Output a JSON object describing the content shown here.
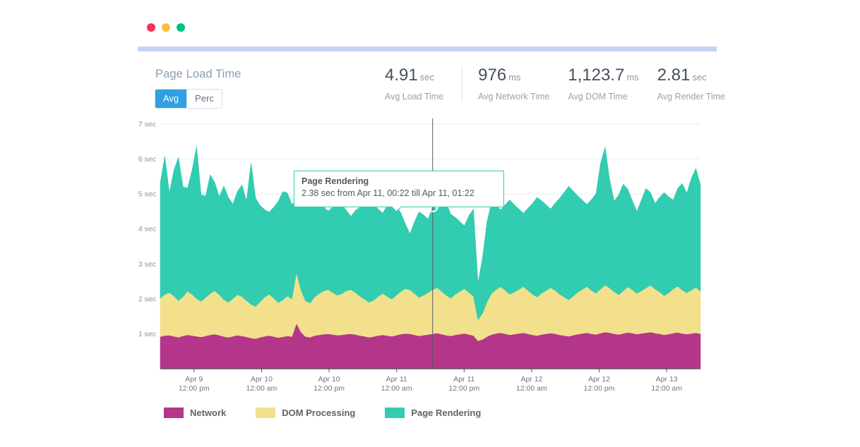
{
  "window": {
    "dots": [
      "close-red",
      "minimize-amber",
      "maximize-green"
    ],
    "accent_bar_color": "#c2d3f7"
  },
  "panel": {
    "title": "Page Load Time",
    "toggle": {
      "options": [
        {
          "label": "Avg",
          "active": true
        },
        {
          "label": "Perc",
          "active": false
        }
      ],
      "active_color": "#30a0e0"
    },
    "metrics": [
      {
        "value": "4.91",
        "unit": "sec",
        "label": "Avg Load Time"
      },
      {
        "value": "976",
        "unit": "ms",
        "label": "Avg Network Time"
      },
      {
        "value": "1,123.7",
        "unit": "ms",
        "label": "Avg DOM Time"
      },
      {
        "value": "2.81",
        "unit": "sec",
        "label": "Avg Render Time"
      }
    ]
  },
  "tooltip": {
    "title": "Page Rendering",
    "body": "2.38 sec from Apr 11, 00:22 till Apr 11, 01:22",
    "border_color": "#32ccb0"
  },
  "legend": [
    {
      "label": "Network",
      "color": "#b4368a"
    },
    {
      "label": "DOM Processing",
      "color": "#f2e08c"
    },
    {
      "label": "Page Rendering",
      "color": "#32ccb0"
    }
  ],
  "chart_data": {
    "type": "area",
    "stacked": true,
    "title": "Page Load Time",
    "xlabel": "",
    "ylabel": "",
    "grid": true,
    "legend_position": "bottom",
    "ylim": [
      0,
      7
    ],
    "yticks": [
      1,
      2,
      3,
      4,
      5,
      6,
      7
    ],
    "ytick_labels": [
      "1 sec",
      "2 sec",
      "3 sec",
      "4 sec",
      "5 sec",
      "6 sec",
      "7 sec"
    ],
    "xtick_labels": [
      [
        "Apr 9",
        "12:00 pm"
      ],
      [
        "Apr 10",
        "12:00 am"
      ],
      [
        "Apr 10",
        "12:00 pm"
      ],
      [
        "Apr 11",
        "12:00 am"
      ],
      [
        "Apr 11",
        "12:00 pm"
      ],
      [
        "Apr 12",
        "12:00 am"
      ],
      [
        "Apr 12",
        "12:00 pm"
      ],
      [
        "Apr 13",
        "12:00 am"
      ]
    ],
    "highlight": {
      "series": "Page Rendering",
      "value": 2.38,
      "x_label": "Apr 11, 00:22"
    },
    "series": [
      {
        "name": "Network",
        "color": "#b4368a",
        "values": [
          0.92,
          0.95,
          0.96,
          0.93,
          0.9,
          0.94,
          0.97,
          0.95,
          0.93,
          0.91,
          0.94,
          0.97,
          0.99,
          0.96,
          0.92,
          0.9,
          0.93,
          0.96,
          0.94,
          0.91,
          0.88,
          0.86,
          0.9,
          0.93,
          0.95,
          0.92,
          0.89,
          0.91,
          0.94,
          0.92,
          1.3,
          1.05,
          0.92,
          0.9,
          0.95,
          0.97,
          0.99,
          1.0,
          0.98,
          0.96,
          0.97,
          0.99,
          1.0,
          0.98,
          0.95,
          0.93,
          0.9,
          0.92,
          0.95,
          0.97,
          0.95,
          0.93,
          0.96,
          0.99,
          1.01,
          1.0,
          0.97,
          0.94,
          0.96,
          0.98,
          1.0,
          1.02,
          0.99,
          0.96,
          0.94,
          0.97,
          0.99,
          1.01,
          0.98,
          0.95,
          0.8,
          0.84,
          0.92,
          0.98,
          1.01,
          1.03,
          1.0,
          0.97,
          0.99,
          1.01,
          1.03,
          1.0,
          0.97,
          0.95,
          0.98,
          1.0,
          1.02,
          1.0,
          0.97,
          0.95,
          0.93,
          0.96,
          0.99,
          1.01,
          1.03,
          1.0,
          0.98,
          1.02,
          1.05,
          1.03,
          1.0,
          0.98,
          1.01,
          1.04,
          1.02,
          0.99,
          1.01,
          1.03,
          1.05,
          1.02,
          1.0,
          0.97,
          0.99,
          1.02,
          1.04,
          1.01,
          0.99,
          1.01,
          1.03,
          1.0
        ],
        "avg": 0.976
      },
      {
        "name": "DOM Processing",
        "color": "#f2e08c",
        "values": [
          1.1,
          1.18,
          1.22,
          1.15,
          1.05,
          1.12,
          1.25,
          1.18,
          1.08,
          1.02,
          1.1,
          1.18,
          1.24,
          1.16,
          1.06,
          1.0,
          1.08,
          1.16,
          1.12,
          1.04,
          0.96,
          0.92,
          1.02,
          1.12,
          1.18,
          1.1,
          1.0,
          1.06,
          1.14,
          1.08,
          1.45,
          1.2,
          1.02,
          0.98,
          1.1,
          1.18,
          1.24,
          1.26,
          1.2,
          1.14,
          1.18,
          1.24,
          1.26,
          1.2,
          1.12,
          1.06,
          1.0,
          1.04,
          1.12,
          1.18,
          1.12,
          1.06,
          1.14,
          1.22,
          1.28,
          1.26,
          1.18,
          1.1,
          1.14,
          1.2,
          1.26,
          1.3,
          1.22,
          1.14,
          1.08,
          1.16,
          1.22,
          1.28,
          1.2,
          1.12,
          0.6,
          0.75,
          1.0,
          1.18,
          1.26,
          1.32,
          1.24,
          1.16,
          1.2,
          1.26,
          1.32,
          1.24,
          1.16,
          1.1,
          1.18,
          1.24,
          1.3,
          1.24,
          1.16,
          1.1,
          1.04,
          1.12,
          1.2,
          1.26,
          1.32,
          1.24,
          1.18,
          1.26,
          1.34,
          1.28,
          1.2,
          1.14,
          1.22,
          1.3,
          1.24,
          1.16,
          1.22,
          1.28,
          1.34,
          1.26,
          1.2,
          1.12,
          1.18,
          1.26,
          1.32,
          1.24,
          1.18,
          1.24,
          1.3,
          1.22
        ],
        "avg": 1.1237
      },
      {
        "name": "Page Rendering",
        "color": "#32ccb0",
        "values": [
          3.3,
          3.95,
          2.85,
          3.6,
          4.1,
          3.15,
          2.95,
          3.55,
          4.35,
          3.05,
          2.9,
          3.4,
          3.1,
          2.8,
          3.25,
          3.0,
          2.7,
          2.95,
          3.2,
          2.85,
          4.05,
          3.1,
          2.75,
          2.5,
          2.35,
          2.6,
          2.9,
          3.1,
          2.95,
          2.7,
          2.05,
          2.6,
          3.0,
          3.15,
          2.9,
          2.6,
          2.4,
          2.25,
          2.45,
          2.7,
          2.55,
          2.3,
          2.1,
          2.35,
          2.55,
          2.8,
          3.0,
          2.75,
          2.5,
          2.3,
          2.6,
          2.85,
          2.55,
          2.25,
          1.85,
          1.6,
          2.05,
          2.45,
          2.3,
          2.1,
          2.38,
          2.25,
          2.45,
          2.65,
          2.4,
          2.2,
          2.0,
          1.8,
          2.2,
          2.5,
          1.05,
          1.6,
          2.3,
          2.6,
          2.4,
          2.2,
          2.45,
          2.7,
          2.5,
          2.3,
          2.1,
          2.35,
          2.6,
          2.85,
          2.65,
          2.45,
          2.25,
          2.5,
          2.75,
          3.0,
          3.25,
          3.0,
          2.75,
          2.55,
          2.35,
          2.6,
          2.85,
          3.6,
          3.95,
          3.1,
          2.6,
          2.85,
          3.05,
          2.8,
          2.55,
          2.35,
          2.6,
          2.85,
          2.65,
          2.45,
          2.7,
          2.95,
          2.75,
          2.55,
          2.8,
          3.05,
          2.85,
          3.2,
          3.4,
          3.05
        ],
        "avg": 2.81
      }
    ]
  }
}
